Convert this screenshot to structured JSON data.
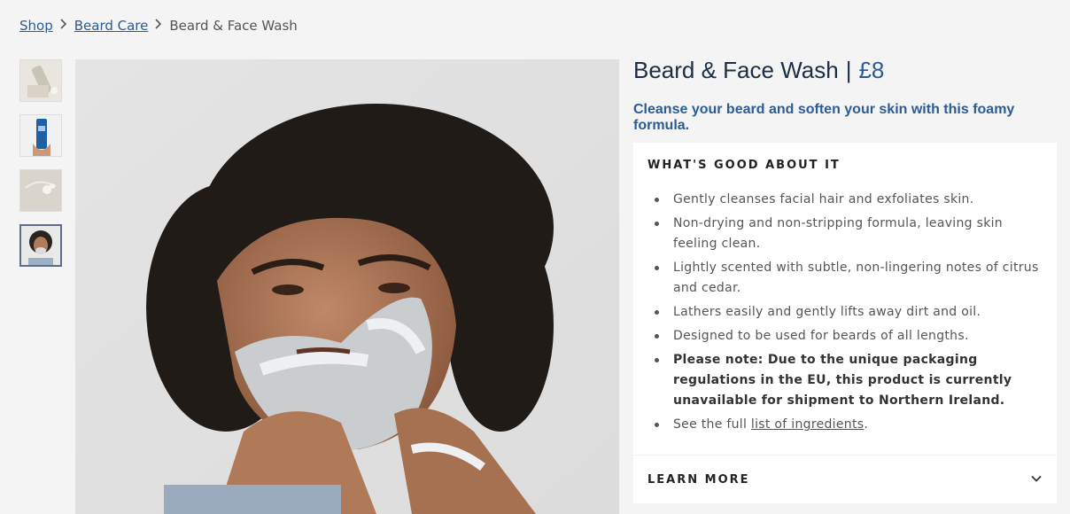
{
  "breadcrumb": {
    "shop": "Shop",
    "category": "Beard Care",
    "current": "Beard & Face Wash"
  },
  "thumbnails": [
    {
      "icon": "product-bottle-icon"
    },
    {
      "icon": "hand-bottle-icon"
    },
    {
      "icon": "foam-icon"
    },
    {
      "icon": "model-face-icon"
    }
  ],
  "product": {
    "name": "Beard & Face Wash",
    "separator": "|",
    "price": "£8",
    "tagline": "Cleanse your beard and soften your skin with this foamy formula."
  },
  "details": {
    "heading": "WHAT'S GOOD ABOUT IT",
    "items": [
      "Gently cleanses facial hair and exfoliates skin.",
      "Non-drying and non-stripping formula, leaving skin feeling clean.",
      "Lightly scented with subtle, non-lingering notes of citrus and cedar.",
      "Lathers easily and gently lifts away dirt and oil.",
      "Designed to be used for beards of all lengths.",
      "Please note: Due to the unique packaging regulations in the EU, this product is currently unavailable for shipment to Northern Ireland."
    ],
    "ingredients_prefix": "See the full ",
    "ingredients_link": "list of ingredients",
    "ingredients_suffix": "."
  },
  "learn_more": {
    "label": "LEARN MORE"
  },
  "colors": {
    "accent": "#2b5c94",
    "heading": "#1c2d44",
    "background": "#f4f4f4"
  }
}
